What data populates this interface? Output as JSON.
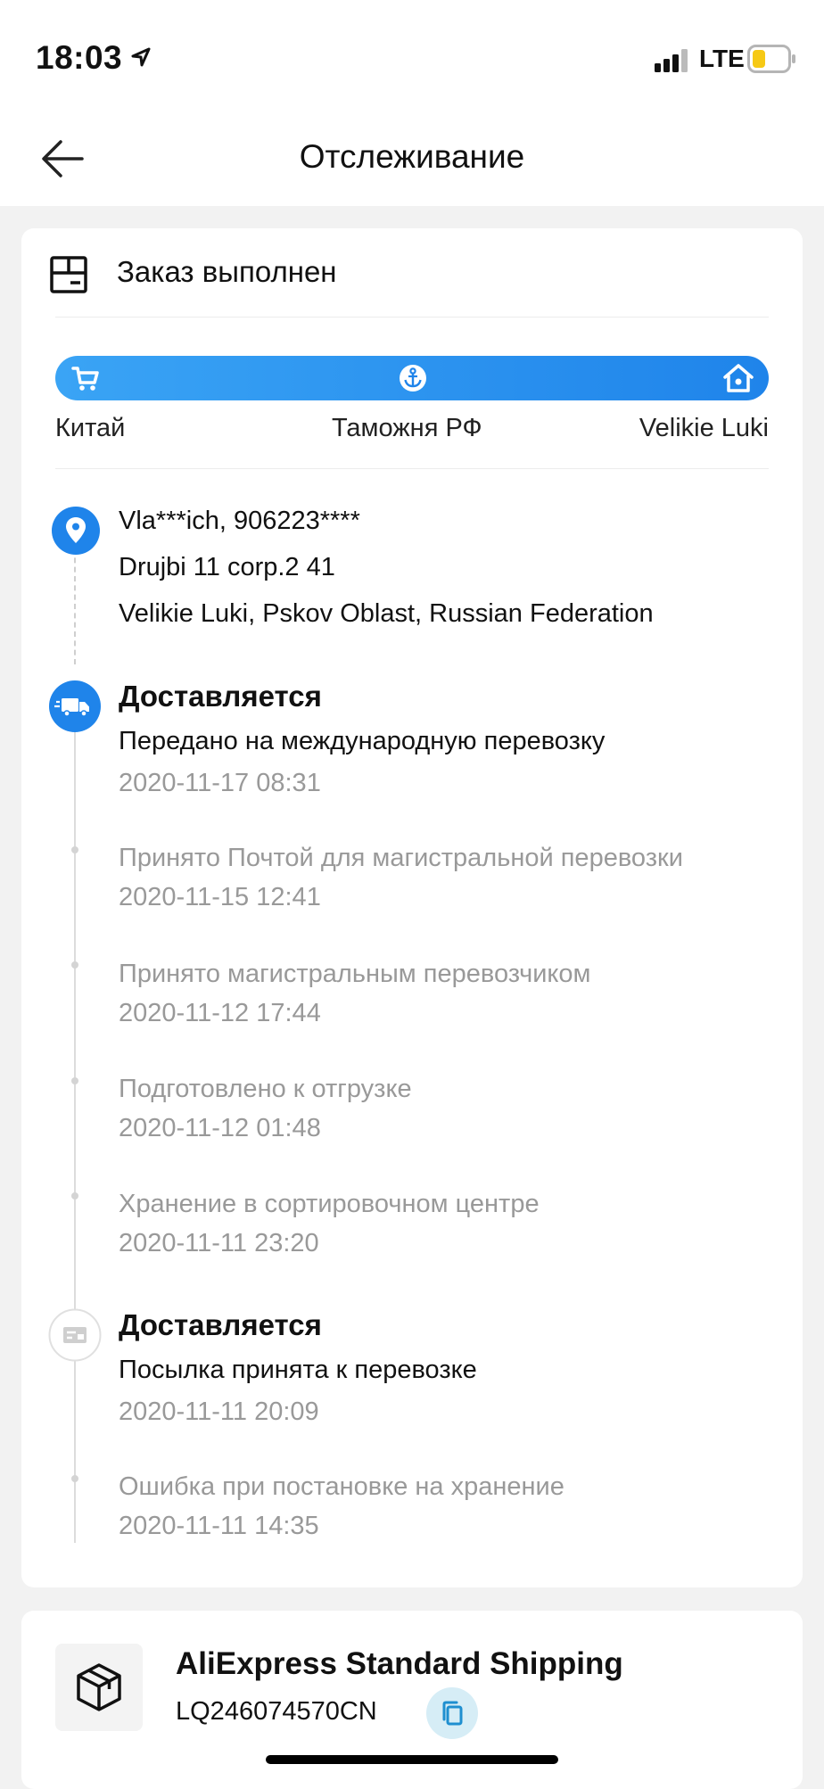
{
  "status_bar": {
    "time": "18:03",
    "network": "LTE"
  },
  "header": {
    "title": "Отслеживание"
  },
  "order": {
    "status": "Заказ выполнен"
  },
  "route": {
    "origin": "Китай",
    "customs": "Таможня РФ",
    "destination": "Velikie Luki"
  },
  "address": {
    "name": "Vla***ich, 906223****",
    "street": "Drujbi 11 corp.2 41",
    "city": "Velikie Luki, Pskov Oblast, Russian Federation"
  },
  "events": [
    {
      "status": "Доставляется",
      "description": "Передано на международную перевозку",
      "time": "2020-11-17 08:31"
    },
    {
      "description": "Принято Почтой для магистральной перевозки",
      "time": "2020-11-15 12:41"
    },
    {
      "description": "Принято магистральным перевозчиком",
      "time": "2020-11-12 17:44"
    },
    {
      "description": "Подготовлено к отгрузке",
      "time": "2020-11-12 01:48"
    },
    {
      "description": "Хранение в сортировочном центре",
      "time": "2020-11-11 23:20"
    },
    {
      "status": "Доставляется",
      "description": "Посылка принята к перевозке",
      "time": "2020-11-11 20:09"
    },
    {
      "description": "Ошибка при постановке на хранение",
      "time": "2020-11-11 14:35"
    }
  ],
  "shipping": {
    "carrier": "AliExpress Standard Shipping",
    "tracking_number": "LQ246074570CN"
  },
  "colors": {
    "accent": "#1f84ea",
    "accent_light": "#3aa4f5",
    "muted_text": "#999999",
    "copy_bg": "#d6edf6"
  },
  "icons": [
    "location-arrow-icon",
    "signal-icon",
    "battery-icon",
    "back-arrow-icon",
    "order-box-icon",
    "cart-icon",
    "anchor-icon",
    "home-icon",
    "location-pin-icon",
    "truck-icon",
    "package-icon",
    "copy-icon"
  ]
}
